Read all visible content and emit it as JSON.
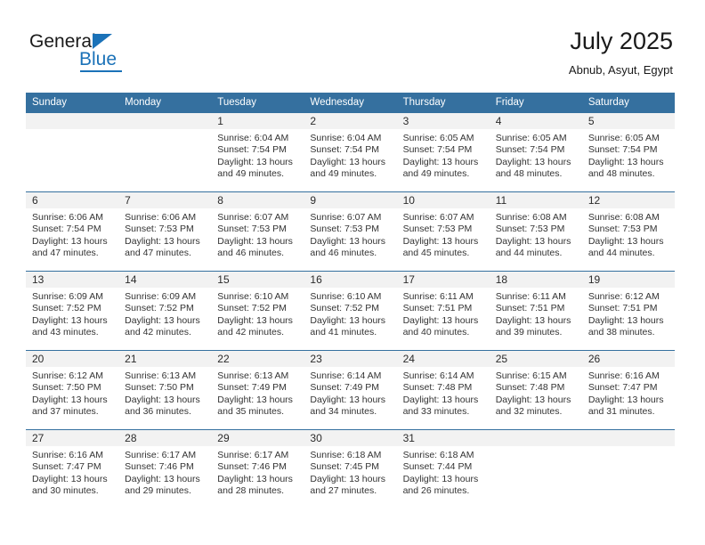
{
  "brand": {
    "name_part1": "General",
    "name_part2": "Blue",
    "triangle_color": "#1b72b8",
    "accent_color": "#1b72b8"
  },
  "header": {
    "title": "July 2025",
    "subtitle": "Abnub, Asyut, Egypt"
  },
  "colors": {
    "header_row_bg": "#35709f",
    "header_row_text": "#ffffff",
    "daynum_bg": "#f2f2f2",
    "row_separator": "#35709f",
    "body_text": "#333333"
  },
  "weekday_headers": [
    "Sunday",
    "Monday",
    "Tuesday",
    "Wednesday",
    "Thursday",
    "Friday",
    "Saturday"
  ],
  "weeks": [
    [
      {
        "day": "",
        "sunrise": "",
        "sunset": "",
        "daylight_line1": "",
        "daylight_line2": ""
      },
      {
        "day": "",
        "sunrise": "",
        "sunset": "",
        "daylight_line1": "",
        "daylight_line2": ""
      },
      {
        "day": "1",
        "sunrise": "Sunrise: 6:04 AM",
        "sunset": "Sunset: 7:54 PM",
        "daylight_line1": "Daylight: 13 hours",
        "daylight_line2": "and 49 minutes."
      },
      {
        "day": "2",
        "sunrise": "Sunrise: 6:04 AM",
        "sunset": "Sunset: 7:54 PM",
        "daylight_line1": "Daylight: 13 hours",
        "daylight_line2": "and 49 minutes."
      },
      {
        "day": "3",
        "sunrise": "Sunrise: 6:05 AM",
        "sunset": "Sunset: 7:54 PM",
        "daylight_line1": "Daylight: 13 hours",
        "daylight_line2": "and 49 minutes."
      },
      {
        "day": "4",
        "sunrise": "Sunrise: 6:05 AM",
        "sunset": "Sunset: 7:54 PM",
        "daylight_line1": "Daylight: 13 hours",
        "daylight_line2": "and 48 minutes."
      },
      {
        "day": "5",
        "sunrise": "Sunrise: 6:05 AM",
        "sunset": "Sunset: 7:54 PM",
        "daylight_line1": "Daylight: 13 hours",
        "daylight_line2": "and 48 minutes."
      }
    ],
    [
      {
        "day": "6",
        "sunrise": "Sunrise: 6:06 AM",
        "sunset": "Sunset: 7:54 PM",
        "daylight_line1": "Daylight: 13 hours",
        "daylight_line2": "and 47 minutes."
      },
      {
        "day": "7",
        "sunrise": "Sunrise: 6:06 AM",
        "sunset": "Sunset: 7:53 PM",
        "daylight_line1": "Daylight: 13 hours",
        "daylight_line2": "and 47 minutes."
      },
      {
        "day": "8",
        "sunrise": "Sunrise: 6:07 AM",
        "sunset": "Sunset: 7:53 PM",
        "daylight_line1": "Daylight: 13 hours",
        "daylight_line2": "and 46 minutes."
      },
      {
        "day": "9",
        "sunrise": "Sunrise: 6:07 AM",
        "sunset": "Sunset: 7:53 PM",
        "daylight_line1": "Daylight: 13 hours",
        "daylight_line2": "and 46 minutes."
      },
      {
        "day": "10",
        "sunrise": "Sunrise: 6:07 AM",
        "sunset": "Sunset: 7:53 PM",
        "daylight_line1": "Daylight: 13 hours",
        "daylight_line2": "and 45 minutes."
      },
      {
        "day": "11",
        "sunrise": "Sunrise: 6:08 AM",
        "sunset": "Sunset: 7:53 PM",
        "daylight_line1": "Daylight: 13 hours",
        "daylight_line2": "and 44 minutes."
      },
      {
        "day": "12",
        "sunrise": "Sunrise: 6:08 AM",
        "sunset": "Sunset: 7:53 PM",
        "daylight_line1": "Daylight: 13 hours",
        "daylight_line2": "and 44 minutes."
      }
    ],
    [
      {
        "day": "13",
        "sunrise": "Sunrise: 6:09 AM",
        "sunset": "Sunset: 7:52 PM",
        "daylight_line1": "Daylight: 13 hours",
        "daylight_line2": "and 43 minutes."
      },
      {
        "day": "14",
        "sunrise": "Sunrise: 6:09 AM",
        "sunset": "Sunset: 7:52 PM",
        "daylight_line1": "Daylight: 13 hours",
        "daylight_line2": "and 42 minutes."
      },
      {
        "day": "15",
        "sunrise": "Sunrise: 6:10 AM",
        "sunset": "Sunset: 7:52 PM",
        "daylight_line1": "Daylight: 13 hours",
        "daylight_line2": "and 42 minutes."
      },
      {
        "day": "16",
        "sunrise": "Sunrise: 6:10 AM",
        "sunset": "Sunset: 7:52 PM",
        "daylight_line1": "Daylight: 13 hours",
        "daylight_line2": "and 41 minutes."
      },
      {
        "day": "17",
        "sunrise": "Sunrise: 6:11 AM",
        "sunset": "Sunset: 7:51 PM",
        "daylight_line1": "Daylight: 13 hours",
        "daylight_line2": "and 40 minutes."
      },
      {
        "day": "18",
        "sunrise": "Sunrise: 6:11 AM",
        "sunset": "Sunset: 7:51 PM",
        "daylight_line1": "Daylight: 13 hours",
        "daylight_line2": "and 39 minutes."
      },
      {
        "day": "19",
        "sunrise": "Sunrise: 6:12 AM",
        "sunset": "Sunset: 7:51 PM",
        "daylight_line1": "Daylight: 13 hours",
        "daylight_line2": "and 38 minutes."
      }
    ],
    [
      {
        "day": "20",
        "sunrise": "Sunrise: 6:12 AM",
        "sunset": "Sunset: 7:50 PM",
        "daylight_line1": "Daylight: 13 hours",
        "daylight_line2": "and 37 minutes."
      },
      {
        "day": "21",
        "sunrise": "Sunrise: 6:13 AM",
        "sunset": "Sunset: 7:50 PM",
        "daylight_line1": "Daylight: 13 hours",
        "daylight_line2": "and 36 minutes."
      },
      {
        "day": "22",
        "sunrise": "Sunrise: 6:13 AM",
        "sunset": "Sunset: 7:49 PM",
        "daylight_line1": "Daylight: 13 hours",
        "daylight_line2": "and 35 minutes."
      },
      {
        "day": "23",
        "sunrise": "Sunrise: 6:14 AM",
        "sunset": "Sunset: 7:49 PM",
        "daylight_line1": "Daylight: 13 hours",
        "daylight_line2": "and 34 minutes."
      },
      {
        "day": "24",
        "sunrise": "Sunrise: 6:14 AM",
        "sunset": "Sunset: 7:48 PM",
        "daylight_line1": "Daylight: 13 hours",
        "daylight_line2": "and 33 minutes."
      },
      {
        "day": "25",
        "sunrise": "Sunrise: 6:15 AM",
        "sunset": "Sunset: 7:48 PM",
        "daylight_line1": "Daylight: 13 hours",
        "daylight_line2": "and 32 minutes."
      },
      {
        "day": "26",
        "sunrise": "Sunrise: 6:16 AM",
        "sunset": "Sunset: 7:47 PM",
        "daylight_line1": "Daylight: 13 hours",
        "daylight_line2": "and 31 minutes."
      }
    ],
    [
      {
        "day": "27",
        "sunrise": "Sunrise: 6:16 AM",
        "sunset": "Sunset: 7:47 PM",
        "daylight_line1": "Daylight: 13 hours",
        "daylight_line2": "and 30 minutes."
      },
      {
        "day": "28",
        "sunrise": "Sunrise: 6:17 AM",
        "sunset": "Sunset: 7:46 PM",
        "daylight_line1": "Daylight: 13 hours",
        "daylight_line2": "and 29 minutes."
      },
      {
        "day": "29",
        "sunrise": "Sunrise: 6:17 AM",
        "sunset": "Sunset: 7:46 PM",
        "daylight_line1": "Daylight: 13 hours",
        "daylight_line2": "and 28 minutes."
      },
      {
        "day": "30",
        "sunrise": "Sunrise: 6:18 AM",
        "sunset": "Sunset: 7:45 PM",
        "daylight_line1": "Daylight: 13 hours",
        "daylight_line2": "and 27 minutes."
      },
      {
        "day": "31",
        "sunrise": "Sunrise: 6:18 AM",
        "sunset": "Sunset: 7:44 PM",
        "daylight_line1": "Daylight: 13 hours",
        "daylight_line2": "and 26 minutes."
      },
      {
        "day": "",
        "sunrise": "",
        "sunset": "",
        "daylight_line1": "",
        "daylight_line2": ""
      },
      {
        "day": "",
        "sunrise": "",
        "sunset": "",
        "daylight_line1": "",
        "daylight_line2": ""
      }
    ]
  ]
}
